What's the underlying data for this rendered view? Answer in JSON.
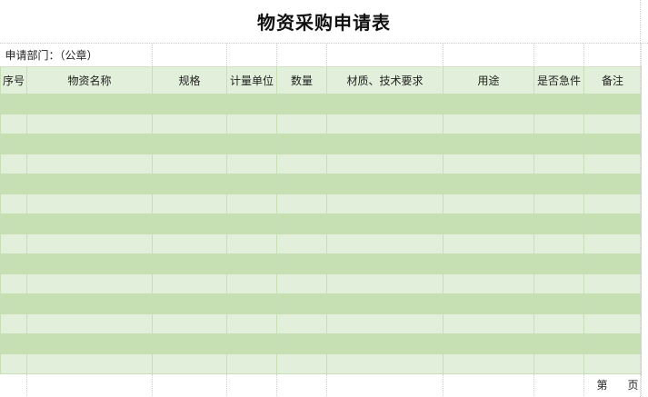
{
  "document": {
    "title": "物资采购申请表",
    "department_label": "申请部门：（公章）",
    "columns": [
      "序号",
      "物资名称",
      "规格",
      "计量单位",
      "数量",
      "材质、技术要求",
      "用途",
      "是否急件",
      "备注"
    ],
    "empty_rows": 14,
    "footer": {
      "page_prefix": "第",
      "page_suffix": "页"
    }
  },
  "colors": {
    "header_fill": "#e2efda",
    "row_dark": "#c6e0b4",
    "row_light": "#e2efda",
    "border": "#c6dfb5"
  }
}
